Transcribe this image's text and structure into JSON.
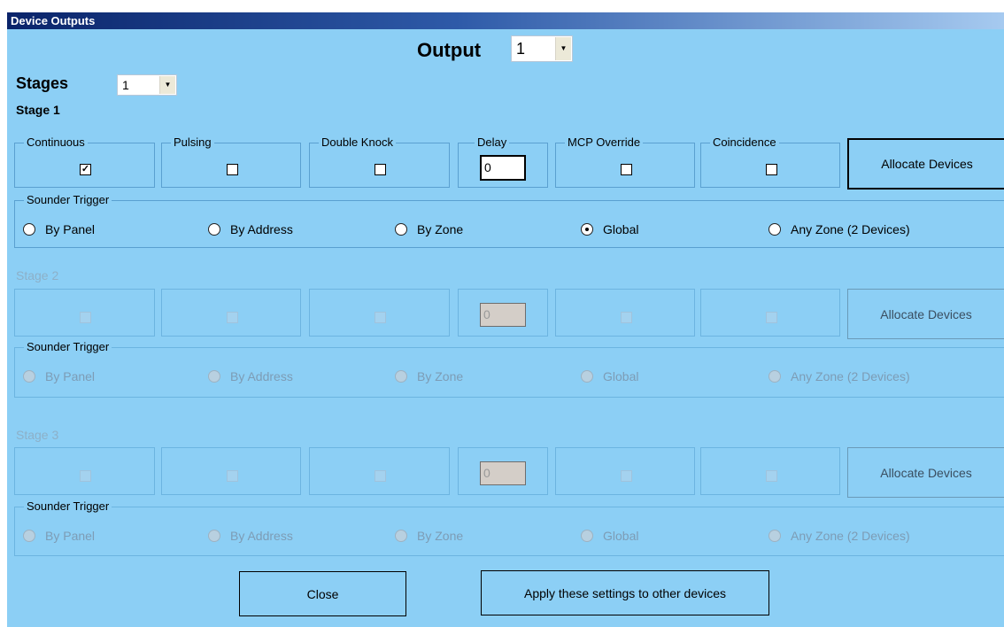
{
  "window": {
    "title": "Device Outputs"
  },
  "output": {
    "label": "Output",
    "value": "1"
  },
  "stages": {
    "label": "Stages",
    "value": "1"
  },
  "stage1": {
    "title": "Stage 1",
    "options": [
      {
        "label": "Continuous",
        "checked": true
      },
      {
        "label": "Pulsing",
        "checked": false
      },
      {
        "label": "Double Knock",
        "checked": false
      },
      {
        "label": "Delay",
        "value": "0"
      },
      {
        "label": "MCP Override",
        "checked": false
      },
      {
        "label": "Coincidence",
        "checked": false
      }
    ],
    "allocate_label": "Allocate Devices",
    "sounder": {
      "label": "Sounder Trigger",
      "options": [
        "By Panel",
        "By Address",
        "By Zone",
        "Global",
        "Any Zone (2 Devices)"
      ],
      "selected": "Global"
    }
  },
  "stage2": {
    "title": "Stage 2",
    "delay_value": "0",
    "allocate_label": "Allocate Devices",
    "sounder": {
      "label": "Sounder Trigger",
      "options": [
        "By Panel",
        "By Address",
        "By Zone",
        "Global",
        "Any Zone (2 Devices)"
      ]
    }
  },
  "stage3": {
    "title": "Stage 3",
    "delay_value": "0",
    "allocate_label": "Allocate Devices",
    "sounder": {
      "label": "Sounder Trigger",
      "options": [
        "By Panel",
        "By Address",
        "By Zone",
        "Global",
        "Any Zone (2 Devices)"
      ]
    }
  },
  "buttons": {
    "close": "Close",
    "apply": "Apply these settings to other devices"
  }
}
